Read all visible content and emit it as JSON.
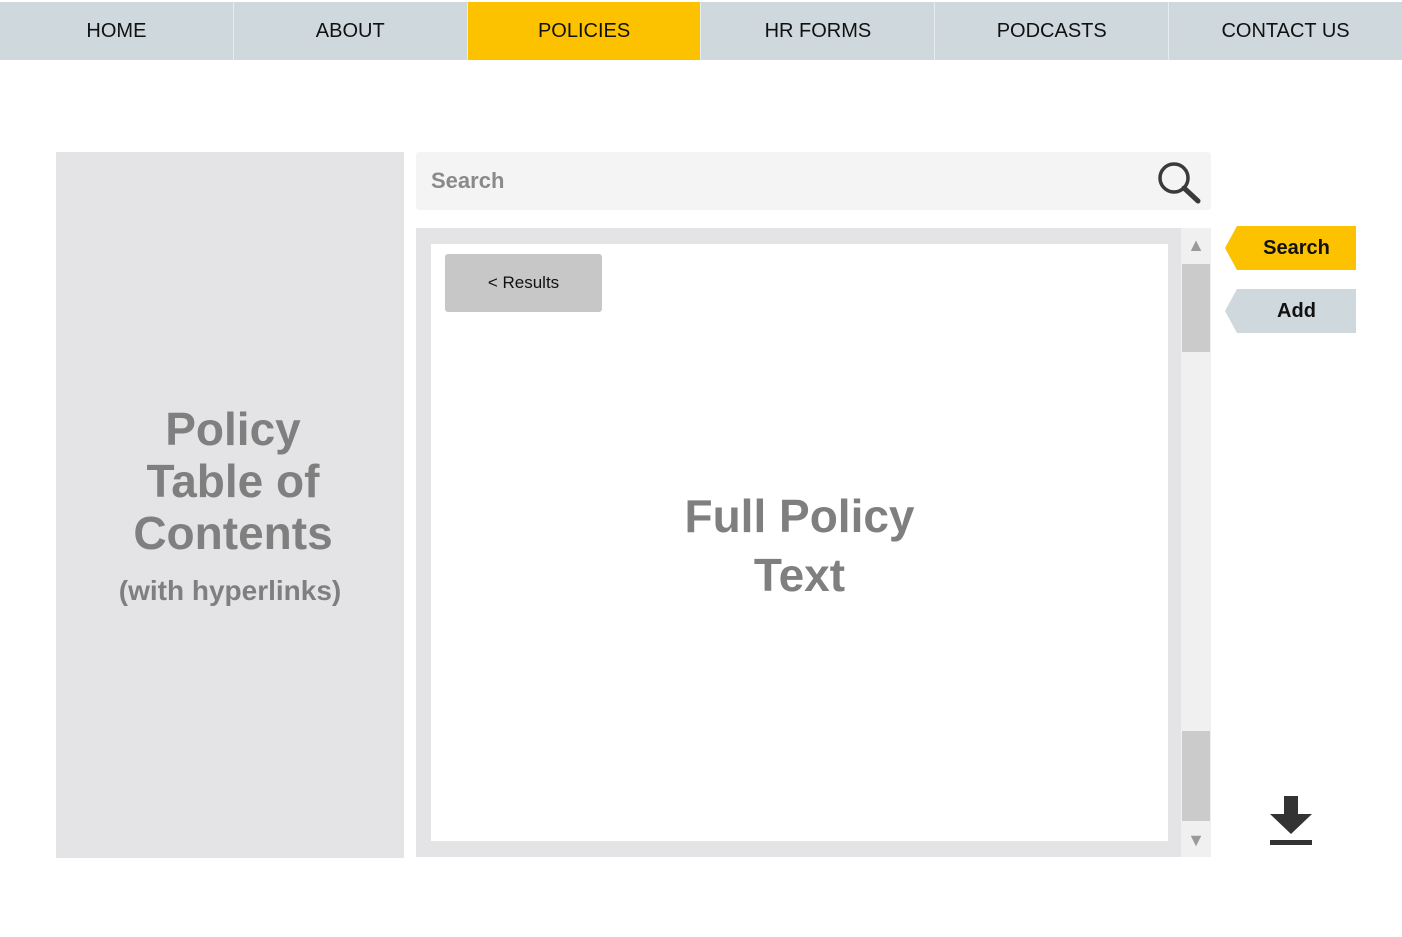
{
  "nav": {
    "items": [
      {
        "label": "HOME",
        "active": false
      },
      {
        "label": "ABOUT",
        "active": false
      },
      {
        "label": "POLICIES",
        "active": true
      },
      {
        "label": "HR FORMS",
        "active": false
      },
      {
        "label": "PODCASTS",
        "active": false
      },
      {
        "label": "CONTACT US",
        "active": false
      }
    ],
    "active_color": "#fcc200",
    "bar_color": "#cfd8dd"
  },
  "toc": {
    "title_line1": "Policy",
    "title_line2": "Table of",
    "title_line3": "Contents",
    "subtitle": "(with hyperlinks)"
  },
  "search": {
    "placeholder": "Search",
    "value": "",
    "icon": "search-icon"
  },
  "policy": {
    "results_label": "< Results",
    "text_line1": "Full Policy",
    "text_line2": "Text"
  },
  "actions": {
    "search_label": "Search",
    "add_label": "Add",
    "download_icon": "download-icon"
  }
}
